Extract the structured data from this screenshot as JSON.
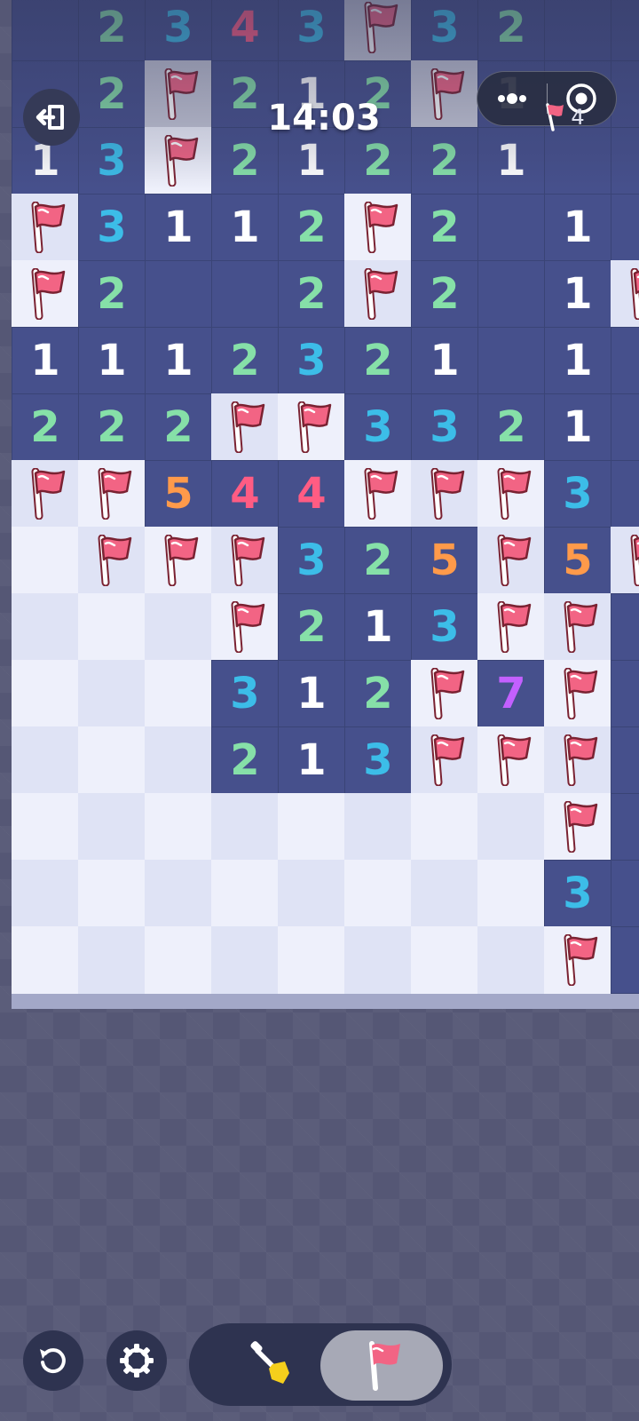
{
  "game": {
    "timer": "14:03",
    "flag_counter": "4",
    "colors": {
      "1": "#ffffff",
      "2": "#86e0a8",
      "3": "#3cbde8",
      "4": "#ff5c83",
      "5": "#ff9a4a",
      "7": "#c360ff",
      "flag": "#f26484",
      "open_cell": "#46508c",
      "hidden_light": "#eef0fb",
      "hidden_dark": "#dfe3f5"
    },
    "board": {
      "legend": "N = revealed number, F = flag, O = open empty, H = hidden, G = pressed/grey hidden",
      "rows": [
        [
          "O",
          "2",
          "3",
          "4",
          "3",
          "GF",
          "3",
          "2",
          "O",
          "O"
        ],
        [
          "O",
          "2",
          "GF",
          "2",
          "1",
          "2",
          "GF",
          "1",
          "O",
          "O"
        ],
        [
          "1",
          "3",
          "F",
          "2",
          "1",
          "2",
          "2",
          "1",
          "O",
          "O"
        ],
        [
          "F",
          "3",
          "1",
          "1",
          "2",
          "F",
          "2",
          "O",
          "1",
          "O"
        ],
        [
          "F",
          "2",
          "O",
          "O",
          "2",
          "F",
          "2",
          "O",
          "1",
          "F"
        ],
        [
          "1",
          "1",
          "1",
          "2",
          "3",
          "2",
          "1",
          "O",
          "1",
          "O"
        ],
        [
          "2",
          "2",
          "2",
          "F",
          "F",
          "3",
          "3",
          "2",
          "1",
          "O"
        ],
        [
          "F",
          "F",
          "5",
          "4",
          "4",
          "F",
          "F",
          "F",
          "3",
          "O"
        ],
        [
          "H",
          "F",
          "F",
          "F",
          "3",
          "2",
          "5",
          "F",
          "5",
          "F"
        ],
        [
          "H",
          "H",
          "H",
          "F",
          "2",
          "1",
          "3",
          "F",
          "F",
          "O"
        ],
        [
          "H",
          "H",
          "H",
          "3",
          "1",
          "2",
          "F",
          "7",
          "F",
          "O"
        ],
        [
          "H",
          "H",
          "H",
          "2",
          "1",
          "3",
          "F",
          "F",
          "F",
          "O"
        ],
        [
          "H",
          "H",
          "H",
          "H",
          "H",
          "H",
          "H",
          "H",
          "F",
          "O"
        ],
        [
          "H",
          "H",
          "H",
          "H",
          "H",
          "H",
          "H",
          "H",
          "3",
          "O"
        ],
        [
          "H",
          "H",
          "H",
          "H",
          "H",
          "H",
          "H",
          "H",
          "F",
          "O"
        ]
      ]
    }
  },
  "icons": {
    "exit": "exit-icon",
    "more": "more-dots-icon",
    "target": "target-icon",
    "restart": "restart-icon",
    "settings": "gear-icon",
    "dig": "shovel-icon",
    "flag": "flag-icon"
  }
}
